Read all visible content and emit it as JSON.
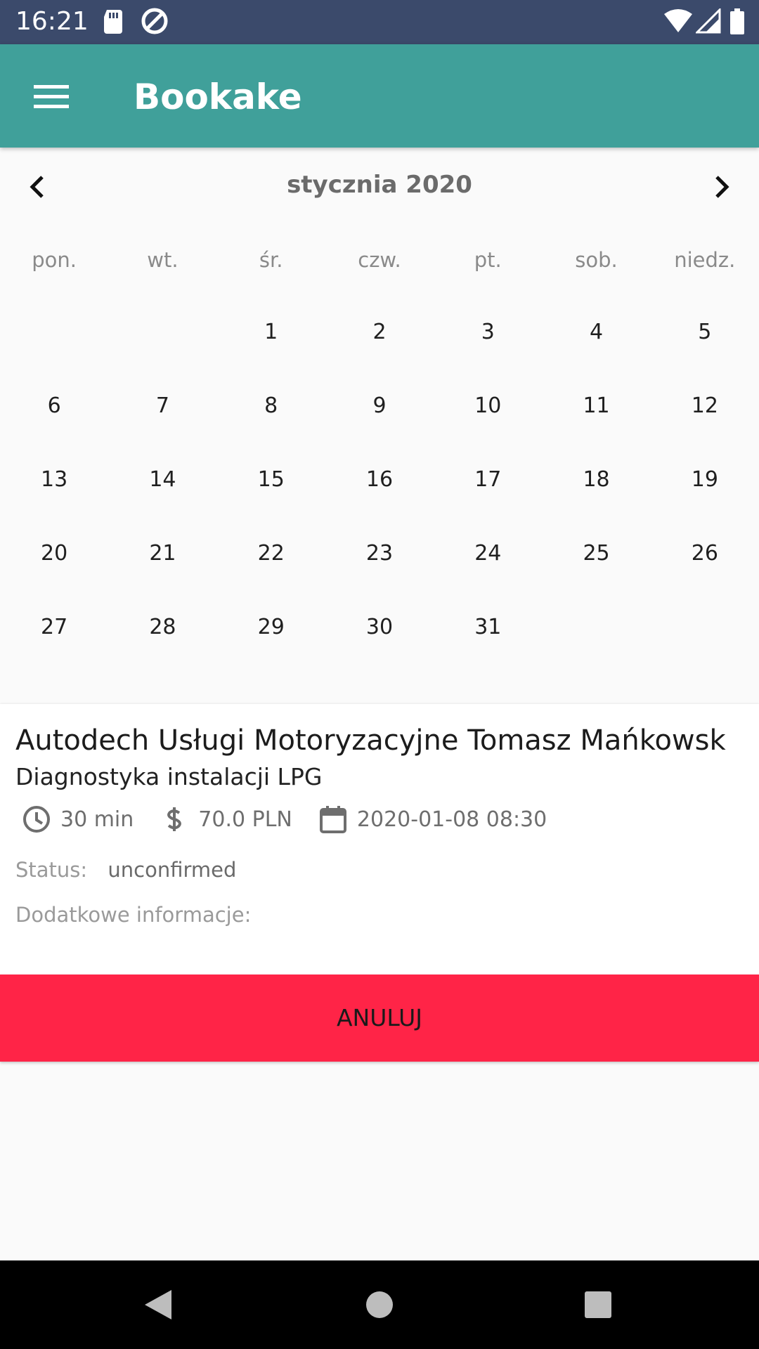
{
  "status_bar": {
    "time": "16:21",
    "icons": [
      "sd-card-icon",
      "sync-icon",
      "wifi-icon",
      "signal-icon",
      "battery-icon"
    ]
  },
  "app_bar": {
    "title": "Bookake",
    "menu_icon": "hamburger-menu-icon",
    "color": "#40a09a"
  },
  "calendar": {
    "month_label": "stycznia 2020",
    "weekdays": [
      "pon.",
      "wt.",
      "śr.",
      "czw.",
      "pt.",
      "sob.",
      "niedz."
    ],
    "days": [
      "",
      "",
      "1",
      "2",
      "3",
      "4",
      "5",
      "6",
      "7",
      "8",
      "9",
      "10",
      "11",
      "12",
      "13",
      "14",
      "15",
      "16",
      "17",
      "18",
      "19",
      "20",
      "21",
      "22",
      "23",
      "24",
      "25",
      "26",
      "27",
      "28",
      "29",
      "30",
      "31",
      "",
      ""
    ]
  },
  "booking": {
    "business_name": "Autodech Usługi Motoryzacyjne Tomasz Mańkowsk",
    "service_name": "Diagnostyka instalacji LPG",
    "duration": "30 min",
    "price": "70.0 PLN",
    "datetime": "2020-01-08 08:30",
    "status_label": "Status:",
    "status_value": "unconfirmed",
    "info_label": "Dodatkowe informacje:",
    "cancel_label": "ANULUJ",
    "cancel_color": "#ff2447"
  },
  "nav_bar": {
    "icons": [
      "back-icon",
      "home-icon",
      "recents-icon"
    ]
  }
}
